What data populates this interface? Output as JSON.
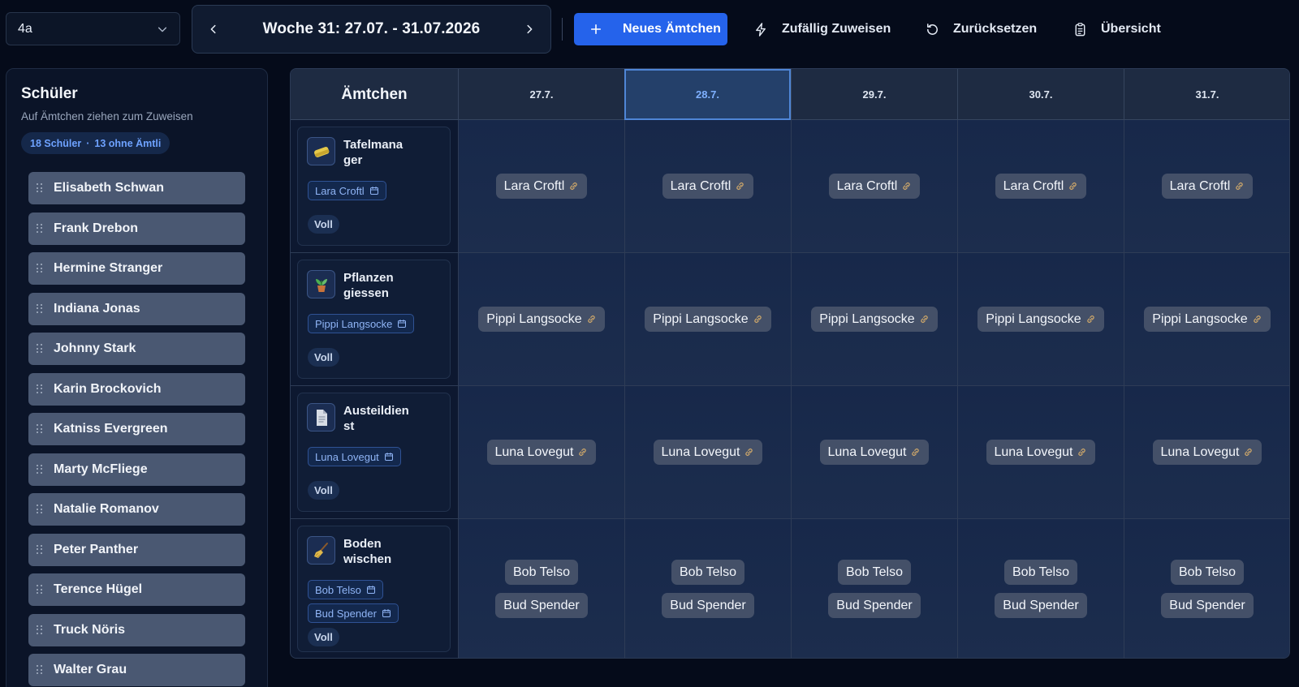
{
  "toolbar": {
    "class_value": "4a",
    "week_label": "Woche 31: 27.07. - 31.07.2026",
    "new_duty_label": "Neues Ämtchen",
    "random_assign_label": "Zufällig Zuweisen",
    "reset_label": "Zurücksetzen",
    "overview_label": "Übersicht"
  },
  "sidebar": {
    "title": "Schüler",
    "subtitle": "Auf Ämtchen ziehen zum Zuweisen",
    "count_students": "18 Schüler",
    "count_separator": "·",
    "count_without": "13 ohne Ämtli",
    "students": [
      "Elisabeth Schwan",
      "Frank Drebon",
      "Hermine Stranger",
      "Indiana Jonas",
      "Johnny Stark",
      "Karin Brockovich",
      "Katniss Evergreen",
      "Marty McFliege",
      "Natalie Romanov",
      "Peter Panther",
      "Terence Hügel",
      "Truck Nöris",
      "Walter Grau"
    ]
  },
  "grid": {
    "header_title": "Ämtchen",
    "days": [
      "27.7.",
      "28.7.",
      "29.7.",
      "30.7.",
      "31.7."
    ],
    "active_day_index": 1,
    "status_label": "Voll",
    "duties": [
      {
        "name": "Tafelmana ger",
        "icon": "sponge-icon",
        "assigned": [
          "Lara Croftl"
        ],
        "cells": [
          [
            "Lara Croftl"
          ],
          [
            "Lara Croftl"
          ],
          [
            "Lara Croftl"
          ],
          [
            "Lara Croftl"
          ],
          [
            "Lara Croftl"
          ]
        ],
        "linked": true
      },
      {
        "name": "Pflanzen giessen",
        "icon": "plant-icon",
        "assigned": [
          "Pippi Langsocke"
        ],
        "cells": [
          [
            "Pippi Langsocke"
          ],
          [
            "Pippi Langsocke"
          ],
          [
            "Pippi Langsocke"
          ],
          [
            "Pippi Langsocke"
          ],
          [
            "Pippi Langsocke"
          ]
        ],
        "linked": true
      },
      {
        "name": "Austeildien st",
        "icon": "document-icon",
        "assigned": [
          "Luna Lovegut"
        ],
        "cells": [
          [
            "Luna Lovegut"
          ],
          [
            "Luna Lovegut"
          ],
          [
            "Luna Lovegut"
          ],
          [
            "Luna Lovegut"
          ],
          [
            "Luna Lovegut"
          ]
        ],
        "linked": true
      },
      {
        "name": "Boden wischen",
        "icon": "broom-icon",
        "assigned": [
          "Bob Telso",
          "Bud Spender"
        ],
        "cells": [
          [
            "Bob Telso",
            "Bud Spender"
          ],
          [
            "Bob Telso",
            "Bud Spender"
          ],
          [
            "Bob Telso",
            "Bud Spender"
          ],
          [
            "Bob Telso",
            "Bud Spender"
          ],
          [
            "Bob Telso",
            "Bud Spender"
          ]
        ],
        "linked": false
      }
    ]
  },
  "colors": {
    "background": "#050b1a",
    "accent": "#2563eb",
    "active_day": "#7fb0ff",
    "link_icon": "#c9a46a"
  }
}
